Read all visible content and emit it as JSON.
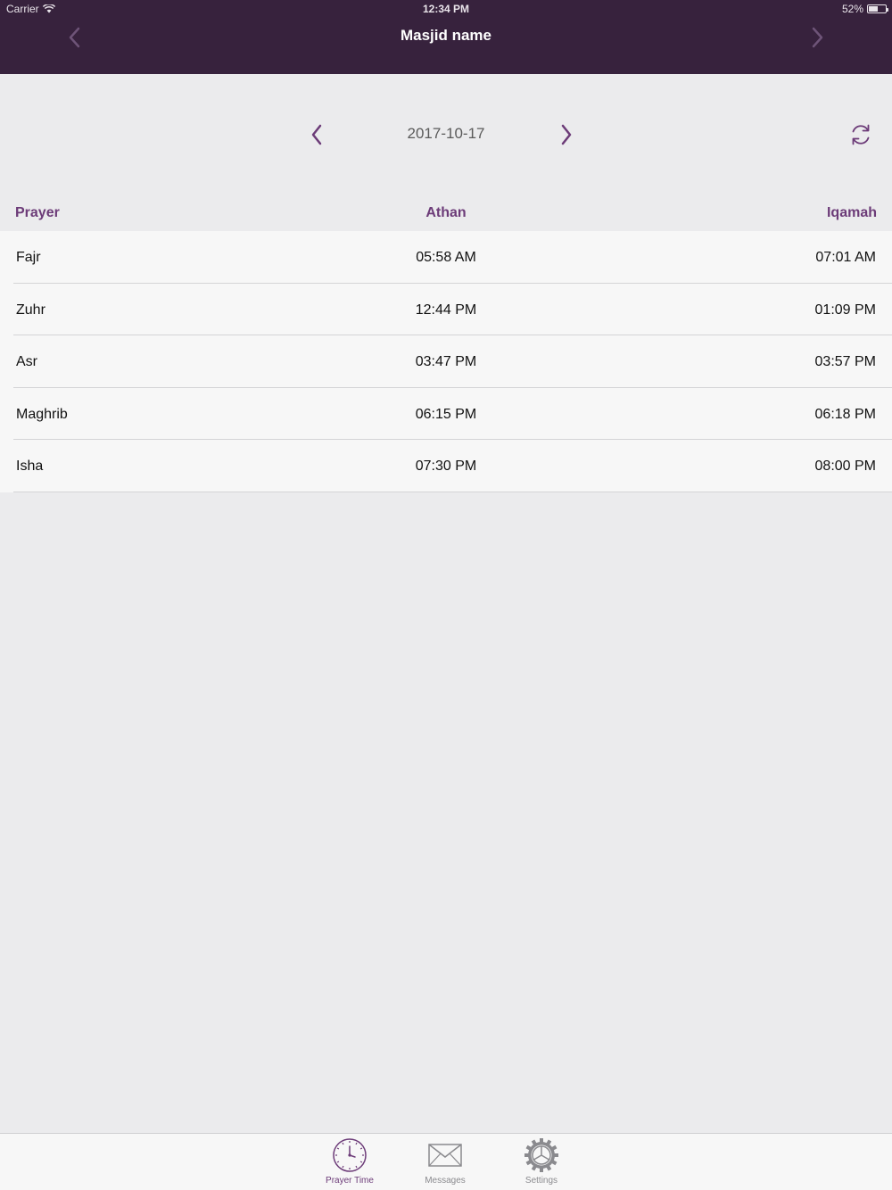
{
  "status": {
    "carrier": "Carrier",
    "time": "12:34 PM",
    "battery": "52%"
  },
  "nav": {
    "title": "Masjid name",
    "left_icon": "chevron-left-icon",
    "right_icon": "chevron-right-icon"
  },
  "date_selector": {
    "date": "2017-10-17"
  },
  "table": {
    "headers": {
      "prayer": "Prayer",
      "athan": "Athan",
      "iqamah": "Iqamah"
    },
    "rows": [
      {
        "name": "Fajr",
        "athan": "05:58 AM",
        "iqamah": "07:01 AM"
      },
      {
        "name": "Zuhr",
        "athan": "12:44 PM",
        "iqamah": "01:09 PM"
      },
      {
        "name": "Asr",
        "athan": "03:47 PM",
        "iqamah": "03:57 PM"
      },
      {
        "name": "Maghrib",
        "athan": "06:15 PM",
        "iqamah": "06:18 PM"
      },
      {
        "name": "Isha",
        "athan": "07:30 PM",
        "iqamah": "08:00 PM"
      }
    ]
  },
  "tabs": [
    {
      "label": "Prayer Time",
      "icon": "clock-icon",
      "active": true
    },
    {
      "label": "Messages",
      "icon": "envelope-icon",
      "active": false
    },
    {
      "label": "Settings",
      "icon": "gear-icon",
      "active": false
    }
  ],
  "colors": {
    "header_bg": "#37223d",
    "accent": "#6c3b78",
    "background": "#ebebed"
  }
}
